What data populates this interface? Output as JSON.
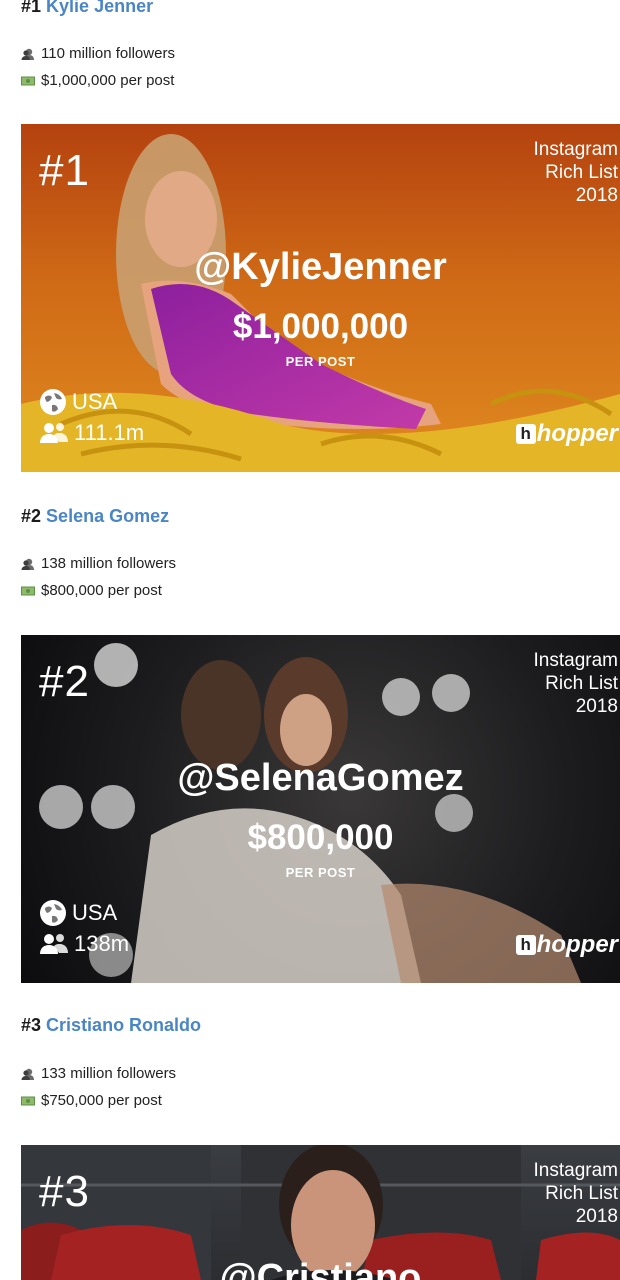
{
  "entries": [
    {
      "rank": "#1",
      "name": "Kylie Jenner",
      "followers_text": "110 million followers",
      "price_text": "$1,000,000 per post",
      "card": {
        "rank": "#1",
        "corner": [
          "Instagram",
          "Rich List",
          "2018"
        ],
        "handle": "@KylieJenner",
        "price": "$1,000,000",
        "per_post": "PER POST",
        "country": "USA",
        "followers": "111.1m",
        "brand": "hopper",
        "brand_mark": "h"
      }
    },
    {
      "rank": "#2",
      "name": "Selena Gomez",
      "followers_text": "138 million followers",
      "price_text": "$800,000 per post",
      "card": {
        "rank": "#2",
        "corner": [
          "Instagram",
          "Rich List",
          "2018"
        ],
        "handle": "@SelenaGomez",
        "price": "$800,000",
        "per_post": "PER POST",
        "country": "USA",
        "followers": "138m",
        "brand": "hopper",
        "brand_mark": "h"
      }
    },
    {
      "rank": "#3",
      "name": "Cristiano Ronaldo",
      "followers_text": "133 million followers",
      "price_text": "$750,000 per post",
      "card": {
        "rank": "#3",
        "corner": [
          "Instagram",
          "Rich List",
          "2018"
        ],
        "handle": "@Cristiano"
      }
    }
  ],
  "icons": {
    "followers": "bust-in-silhouette-icon",
    "price": "dollar-banknote-icon",
    "country": "globe-icon",
    "audience": "people-icon"
  },
  "colors": {
    "link": "#4a86c5",
    "card1_bg": "#cf6a16",
    "card2_bg": "#1d1d1f",
    "card3_bg": "#2b2d31"
  }
}
